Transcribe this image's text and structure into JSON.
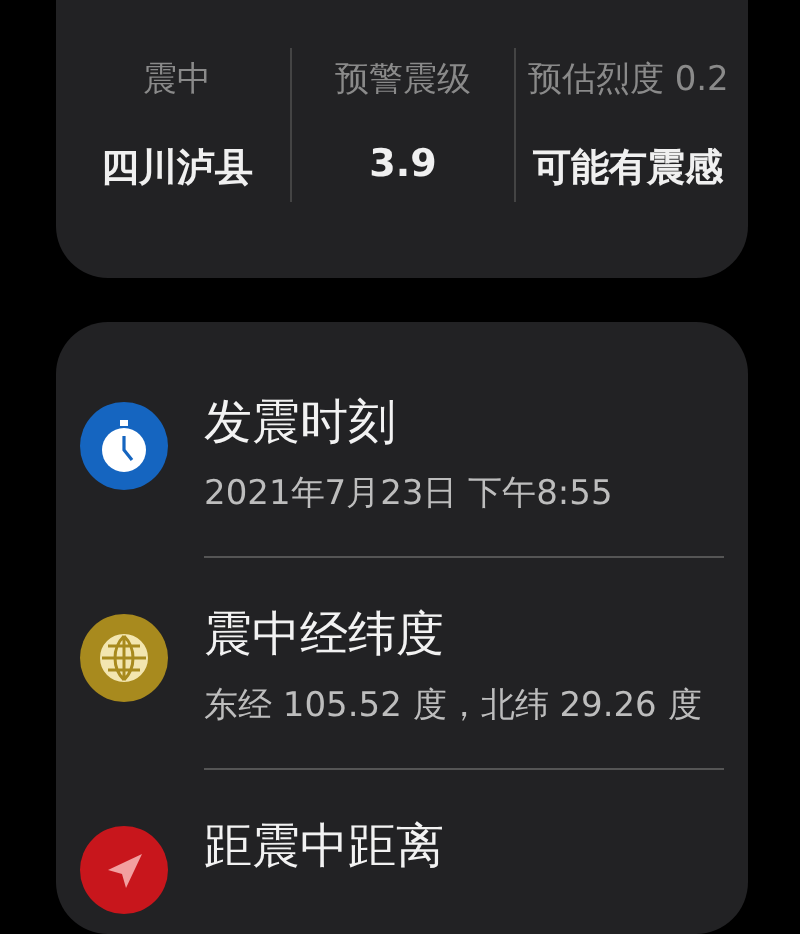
{
  "summary": [
    {
      "label": "震中",
      "value": "四川泸县"
    },
    {
      "label": "预警震级",
      "value": "3.9"
    },
    {
      "label": "预估烈度 0.2",
      "value": "可能有震感"
    }
  ],
  "details": [
    {
      "kind": "clock",
      "color": "#1565c0",
      "title": "发震时刻",
      "value": "2021年7月23日 下午8:55"
    },
    {
      "kind": "globe",
      "color": "#a88a1e",
      "title": "震中经纬度",
      "value": "东经 105.52 度，北纬 29.26 度"
    },
    {
      "kind": "pointer",
      "color": "#c8161c",
      "title": "距震中距离"
    }
  ]
}
